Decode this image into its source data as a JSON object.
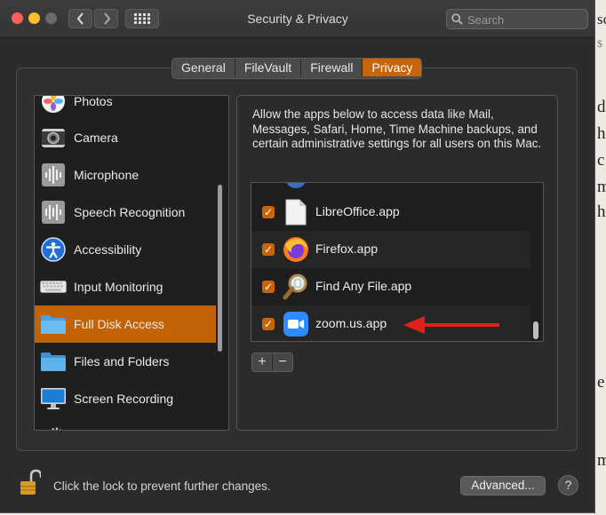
{
  "window": {
    "title": "Security & Privacy"
  },
  "search": {
    "placeholder": "Search"
  },
  "tabs": [
    {
      "label": "General"
    },
    {
      "label": "FileVault"
    },
    {
      "label": "Firewall"
    },
    {
      "label": "Privacy",
      "active": true
    }
  ],
  "sidebar": {
    "items": [
      {
        "label": "Photos",
        "icon": "photos-icon"
      },
      {
        "label": "Camera",
        "icon": "camera-icon"
      },
      {
        "label": "Microphone",
        "icon": "microphone-icon"
      },
      {
        "label": "Speech Recognition",
        "icon": "speech-recognition-icon"
      },
      {
        "label": "Accessibility",
        "icon": "accessibility-icon"
      },
      {
        "label": "Input Monitoring",
        "icon": "keyboard-icon"
      },
      {
        "label": "Full Disk Access",
        "icon": "folder-icon",
        "selected": true
      },
      {
        "label": "Files and Folders",
        "icon": "folder-icon"
      },
      {
        "label": "Screen Recording",
        "icon": "display-icon"
      }
    ]
  },
  "description": "Allow the apps below to access data like Mail, Messages, Safari, Home, Time Machine backups, and certain administrative settings for all users on this Mac.",
  "apps": [
    {
      "label": "LibreOffice.app",
      "checked": true,
      "icon": "libreoffice-icon"
    },
    {
      "label": "Firefox.app",
      "checked": true,
      "icon": "firefox-icon"
    },
    {
      "label": "Find Any File.app",
      "checked": true,
      "icon": "find-any-file-icon"
    },
    {
      "label": "zoom.us.app",
      "checked": true,
      "icon": "zoom-icon"
    }
  ],
  "controls": {
    "add": "+",
    "remove": "−"
  },
  "footer": {
    "lock_text": "Click the lock to prevent further changes.",
    "advanced_label": "Advanced...",
    "help_label": "?"
  },
  "background_fragments": [
    "sc",
    "$",
    "d",
    "he",
    "c",
    "m",
    "he",
    "e",
    "m"
  ],
  "colors": {
    "accent": "#c8650b",
    "annotation_arrow": "#e0201b"
  }
}
